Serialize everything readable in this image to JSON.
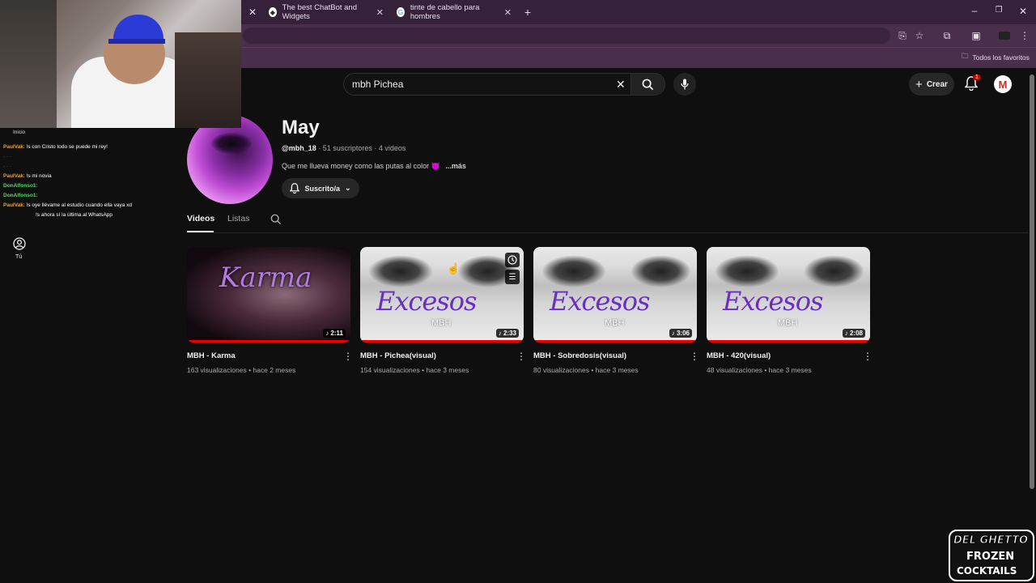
{
  "browser": {
    "tabs": [
      {
        "title": "The best ChatBot and Widgets"
      },
      {
        "title": "tinte de cabello para hombres"
      }
    ],
    "bookmarks_label": "Todos los favoritos"
  },
  "youtube": {
    "search_value": "mbh Pichea",
    "create_label": "Crear",
    "notification_count": "1",
    "account_initial": "M",
    "sidebar": {
      "you_label": "Tú",
      "home_label": "Inicio"
    },
    "channel": {
      "name": "May",
      "handle": "@mbh_18",
      "meta": "· 51 suscriptores · 4 videos",
      "description": "Que me llueva money como las putas al color 👿",
      "more": "...más",
      "subscribe_label": "Suscrito/a"
    },
    "tabs": [
      {
        "label": "Videos"
      },
      {
        "label": "Listas"
      }
    ],
    "videos": [
      {
        "title": "MBH - Karma",
        "meta": "163 visualizaciones • hace 2 meses",
        "duration": "2:11",
        "thumb_text": "Karma"
      },
      {
        "title": "MBH - Pichea(visual)",
        "meta": "154 visualizaciones • hace 3 meses",
        "duration": "2:33",
        "thumb_text": "Excesos",
        "thumb_sub": "MBH"
      },
      {
        "title": "MBH - Sobredosis(visual)",
        "meta": "80 visualizaciones • hace 3 meses",
        "duration": "3:06",
        "thumb_text": "Excesos",
        "thumb_sub": "MBH"
      },
      {
        "title": "MBH - 420(visual)",
        "meta": "48 visualizaciones • hace 3 meses",
        "duration": "2:08",
        "thumb_text": "Excesos",
        "thumb_sub": "MBH"
      }
    ]
  },
  "stream_chat": [
    {
      "user": "PaulVak",
      "msg": ": !s con Cristo todo se puede mi rey!"
    },
    {
      "user": "DonAlfonso1",
      "msg": ":"
    },
    {
      "user": "PaulVak",
      "msg": ": !s oye llévame al estudio cuando ella vaya xd"
    },
    {
      "user": "",
      "msg": "!s ahora sí la última al WhatsApp"
    }
  ],
  "stream_chat_extra": [
    {
      "user": "PaulVak",
      "msg": ": !s mi novia"
    },
    {
      "user": "DonAlfonso1",
      "msg": ":"
    }
  ],
  "watermark": {
    "line1": "DEL GHETTO",
    "line2": "FROZEN",
    "line3": "COCKTAILS"
  },
  "colors": {
    "bg": "#0f0f0f",
    "accent_red": "#e00000",
    "thumb_purple": "#6a2fc2",
    "tab_bar": "#35223a"
  }
}
